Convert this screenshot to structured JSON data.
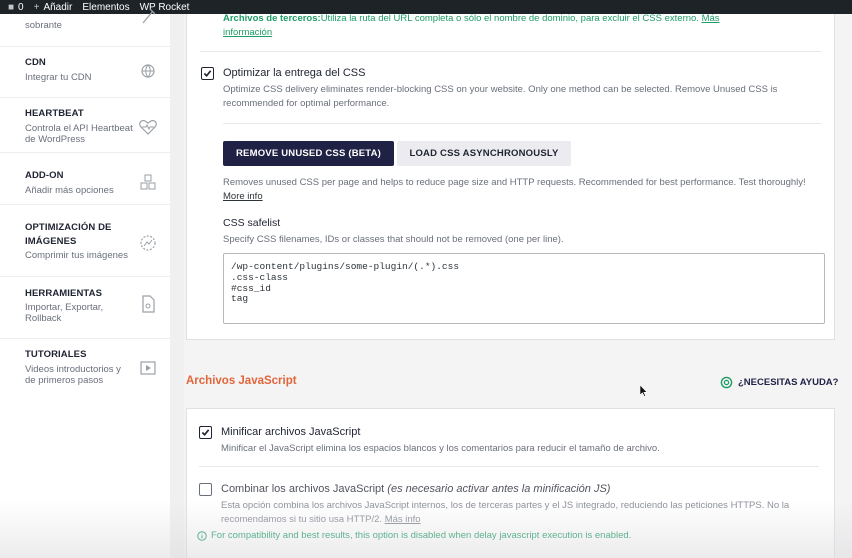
{
  "admin_bar": {
    "comments_count": "0",
    "add_label": "Añadir",
    "elementos_label": "Elementos",
    "wp_rocket_label": "WP Rocket"
  },
  "sidebar": {
    "items": [
      {
        "title": "",
        "desc": "sobrante",
        "icon": "broom-icon"
      },
      {
        "title": "CDN",
        "desc": "Integrar tu CDN",
        "icon": "cdn-globe-icon"
      },
      {
        "title": "HEARTBEAT",
        "desc": "Controla el API Heartbeat",
        "desc2": "de WordPress",
        "icon": "heartbeat-icon"
      },
      {
        "title": "ADD-ON",
        "desc": "Añadir más opciones",
        "icon": "addon-cubes-icon"
      },
      {
        "title": "OPTIMIZACIÓN DE",
        "title2": "IMÁGENES",
        "desc": "Comprimir tus imágenes",
        "icon": "image-optimization-icon"
      },
      {
        "title": "HERRAMIENTAS",
        "desc": "Importar, Exportar,",
        "desc2": "Rollback",
        "icon": "tools-file-icon"
      },
      {
        "title": "TUTORIALES",
        "desc": "Videos introductorios y",
        "desc2": "de primeros pasos",
        "icon": "video-play-icon"
      }
    ]
  },
  "css_section": {
    "third_party_label": "Archivos de terceros:",
    "third_party_text": "Utiliza la ruta del URL completa o sólo el nombre de dominio, para excluir el CSS externo.",
    "third_party_link_1": "Más",
    "third_party_link_2": "información",
    "optimize_title": "Optimizar la entrega del CSS",
    "optimize_desc_1": "Optimize CSS delivery eliminates render-blocking CSS on your website. Only one method can be selected. Remove Unused CSS is",
    "optimize_desc_2": "recommended for optimal performance.",
    "btn_remove_unused": "REMOVE UNUSED CSS (BETA)",
    "btn_load_async": "LOAD CSS ASYNCHRONOUSLY",
    "remove_desc": "Removes unused CSS per page and helps to reduce page size and HTTP requests. Recommended for best performance. Test thoroughly!",
    "more_info": "More info",
    "safelist_title": "CSS safelist",
    "safelist_desc": "Specify CSS filenames, IDs or classes that should not be removed (one per line).",
    "safelist_value": "/wp-content/plugins/some-plugin/(.*).css\n.css-class\n#css_id\ntag"
  },
  "js_section": {
    "title": "Archivos JavaScript",
    "help_label": "¿NECESITAS AYUDA?",
    "minify_title": "Minificar archivos JavaScript",
    "minify_desc": "Minificar el JavaScript elimina los espacios blancos y los comentarios para reducir el tamaño de archivo.",
    "combine_title": "Combinar los archivos JavaScript",
    "combine_note": "(es necesario activar antes la minificación JS)",
    "combine_desc_1": "Esta opción combina los archivos JavaScript internos, los de terceras partes y el JS integrado, reduciendo las peticiones HTTPS. No la",
    "combine_desc_2": "recomendamos si tu sitio usa HTTP/2.",
    "combine_more": "Más info",
    "compat_notice": "For compatibility and best results, this option is disabled when delay javascript execution is enabled."
  },
  "colors": {
    "accent_orange": "#e2653a",
    "brand_dark": "#1f2145",
    "link_green": "#1f9c67"
  }
}
